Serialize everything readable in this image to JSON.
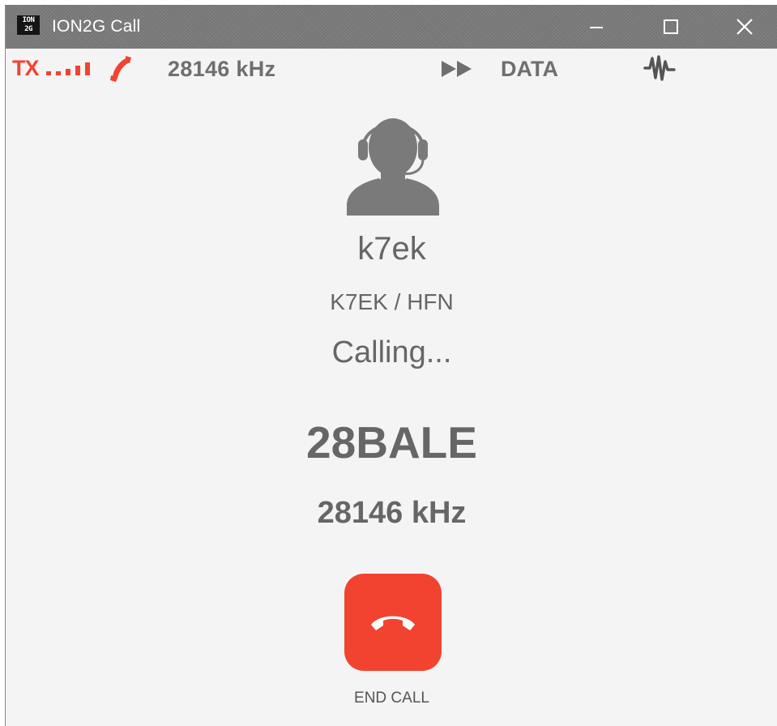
{
  "window": {
    "title": "ION2G Call",
    "logo_text": "ION\n2G"
  },
  "status_bar": {
    "tx_label": "TX",
    "signal_level": 4,
    "frequency": "28146 kHz",
    "mode": "DATA",
    "icons": [
      "signal-bars-icon",
      "phone-icon",
      "fast-forward-icon",
      "waveform-icon"
    ]
  },
  "call": {
    "contact_name": "k7ek",
    "contact_address": "K7EK / HFN",
    "status": "Calling...",
    "channel": "28BALE",
    "frequency": "28146 kHz",
    "end_call_label": "END CALL"
  },
  "colors": {
    "accent": "#f24331",
    "text": "#666666",
    "background": "#f4f4f4",
    "titlebar": "#7a7a7a"
  }
}
